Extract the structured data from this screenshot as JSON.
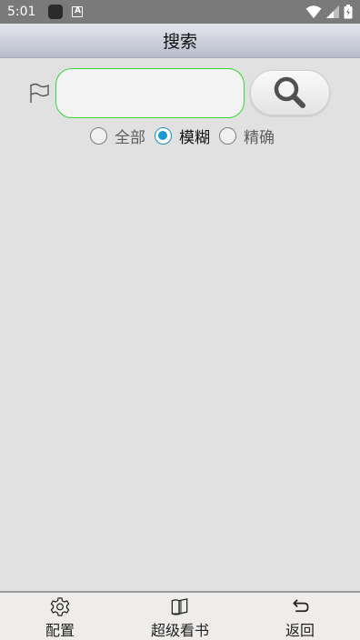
{
  "status_bar": {
    "time": "5:01",
    "icons": [
      "app-icon",
      "a-icon",
      "wifi-icon",
      "signal-icon",
      "battery-icon"
    ]
  },
  "header": {
    "title": "搜索"
  },
  "search": {
    "value": "",
    "placeholder": "",
    "border_color": "#38d638",
    "button_icon": "search-icon",
    "flag_icon": "flag-icon"
  },
  "mode_options": [
    {
      "label": "全部",
      "checked": false
    },
    {
      "label": "模糊",
      "checked": true
    },
    {
      "label": "精确",
      "checked": false
    }
  ],
  "colors": {
    "accent": "#1a9bd0",
    "background": "#e1e1e1"
  },
  "bottom_nav": [
    {
      "label": "配置",
      "icon": "gear-icon"
    },
    {
      "label": "超级看书",
      "icon": "book-icon"
    },
    {
      "label": "返回",
      "icon": "back-arrow-icon"
    }
  ]
}
